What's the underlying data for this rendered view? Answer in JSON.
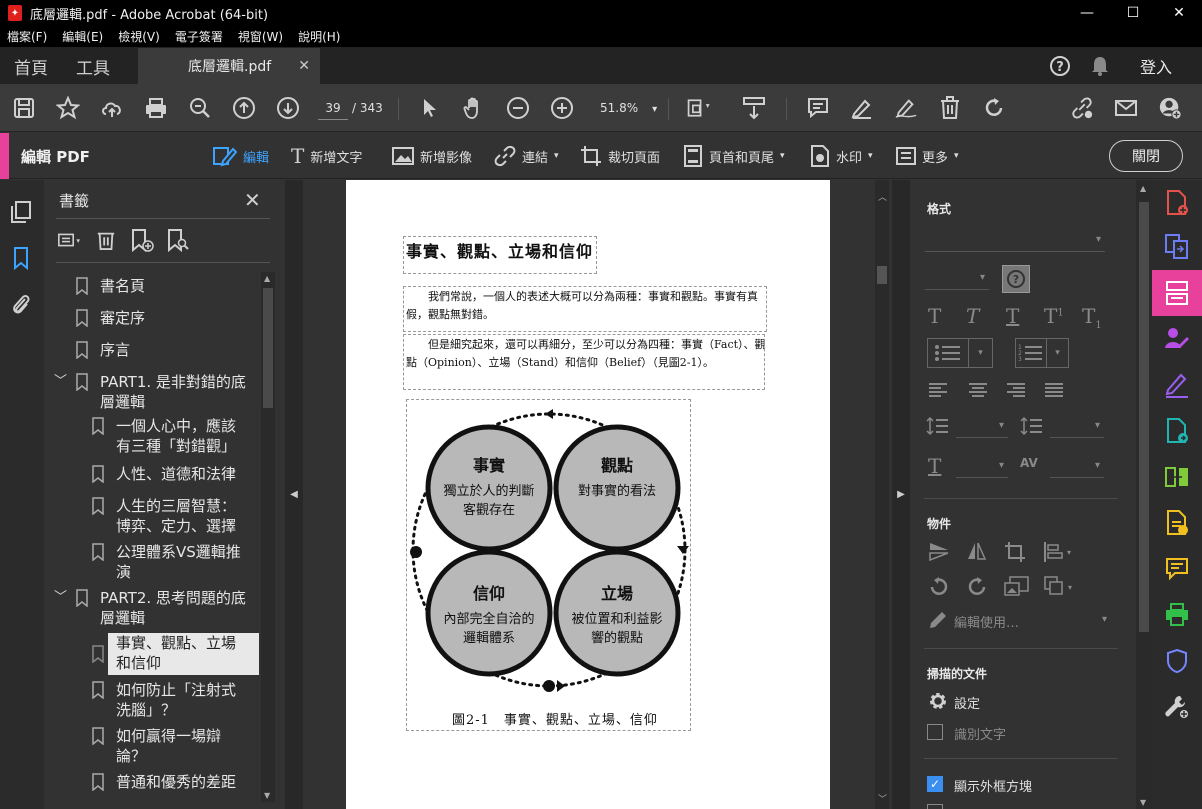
{
  "window": {
    "title": "底層邏輯.pdf - Adobe Acrobat (64-bit)",
    "app_icon": "acrobat-icon",
    "controls": [
      "minimize",
      "maximize",
      "close"
    ]
  },
  "menu": [
    "檔案(F)",
    "編輯(E)",
    "檢視(V)",
    "電子簽署",
    "視窗(W)",
    "說明(H)"
  ],
  "tabs": {
    "home": "首頁",
    "tools": "工具",
    "document": "底層邏輯.pdf",
    "signin": "登入"
  },
  "toolbar": {
    "page_current": "39",
    "page_total": "/ 343",
    "zoom": "51.8%"
  },
  "edit_bar": {
    "label": "編輯 PDF",
    "tools": [
      "編輯",
      "新增文字",
      "新增影像",
      "連結",
      "裁切頁面",
      "頁首和頁尾",
      "水印",
      "更多"
    ],
    "close": "關閉"
  },
  "bookmarks": {
    "header": "書籤",
    "items": [
      {
        "label": "書名頁"
      },
      {
        "label": "審定序"
      },
      {
        "label": "序言"
      },
      {
        "label": "PART1. 是非對錯的底層邏輯"
      },
      {
        "label": "一個人心中，應該有三種「對錯觀」"
      },
      {
        "label": "人性、道德和法律"
      },
      {
        "label": "人生的三層智慧：博弈、定力、選擇"
      },
      {
        "label": "公理體系VS邏輯推演"
      },
      {
        "label": "PART2. 思考問題的底層邏輯"
      },
      {
        "label": "事實、觀點、立場和信仰"
      },
      {
        "label": "如何防止「注射式洗腦」？"
      },
      {
        "label": "如何贏得一場辯論？"
      },
      {
        "label": "普通和優秀的差距"
      }
    ]
  },
  "document_page": {
    "title": "事實、觀點、立場和信仰",
    "para1": "我們常說，一個人的表述大概可以分為兩種：事實和觀點。事實有真假，觀點無對錯。",
    "para2": "但是細究起來，還可以再細分，至少可以分為四種：事實（Fact）、觀點（Opinion）、立場（Stand）和信仰（Belief）（見圖2-1）。",
    "figure": {
      "circles": [
        {
          "title": "事實",
          "desc_line1": "獨立於人的判斷",
          "desc_line2": "客觀存在"
        },
        {
          "title": "觀點",
          "desc_line1": "對事實的看法",
          "desc_line2": ""
        },
        {
          "title": "信仰",
          "desc_line1": "內部完全自洽的",
          "desc_line2": "邏輯體系"
        },
        {
          "title": "立場",
          "desc_line1": "被位置和利益影",
          "desc_line2": "響的觀點"
        }
      ],
      "caption": "圖2-1　事實、觀點、立場、信仰"
    }
  },
  "format_panel": {
    "format_header": "格式",
    "objects_header": "物件",
    "edit_using": "編輯使用…",
    "scanned_header": "掃描的文件",
    "settings": "設定",
    "recognize_text": "識別文字",
    "show_bbox": "顯示外框方塊",
    "show_bbox_checked": true
  },
  "colors": {
    "accent_pink": "#e8419b",
    "active_blue": "#3ca3ff",
    "checkbox_blue": "#3a8ff0"
  }
}
